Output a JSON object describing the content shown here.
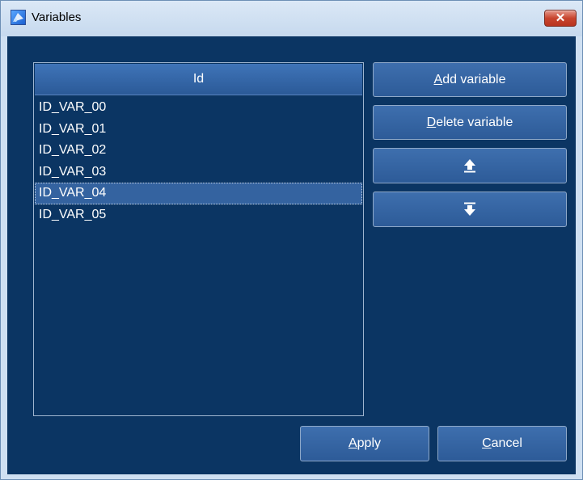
{
  "window": {
    "title": "Variables",
    "close_label": "✕"
  },
  "list": {
    "header": "Id",
    "items": [
      "ID_VAR_00",
      "ID_VAR_01",
      "ID_VAR_02",
      "ID_VAR_03",
      "ID_VAR_04",
      "ID_VAR_05"
    ],
    "selected_index": 4
  },
  "buttons": {
    "add": {
      "mnemonic": "A",
      "rest": "dd variable"
    },
    "delete": {
      "mnemonic": "D",
      "rest": "elete variable"
    },
    "move_up_icon": "move-up-icon",
    "move_down_icon": "move-down-icon",
    "apply": {
      "mnemonic": "A",
      "rest": "pply"
    },
    "cancel": {
      "mnemonic": "C",
      "rest": "ancel"
    }
  },
  "colors": {
    "background": "#0b3563",
    "button": "#2d5b98",
    "selection": "#3463a0"
  }
}
